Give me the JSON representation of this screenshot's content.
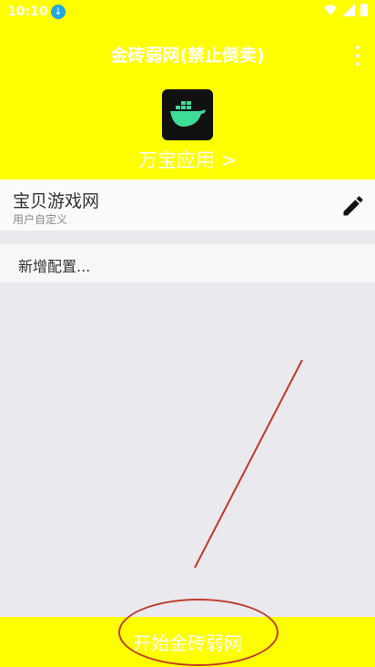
{
  "status_bar": {
    "time": "10:10",
    "download_icon": "download-icon"
  },
  "header": {
    "title": "金砖弱网(禁止倒卖)",
    "logo_icon": "docker-whale-icon",
    "store_link": "万宝应用 >",
    "colors": {
      "background": "#ffff00",
      "text": "#ffffff"
    }
  },
  "config": {
    "name": "宝贝游戏网",
    "subtitle": "用户自定义",
    "edit_icon": "pencil-icon"
  },
  "add_config": {
    "label": "新增配置..."
  },
  "footer": {
    "start_label": "开始金砖弱网",
    "highlight_color": "#c0392b"
  }
}
